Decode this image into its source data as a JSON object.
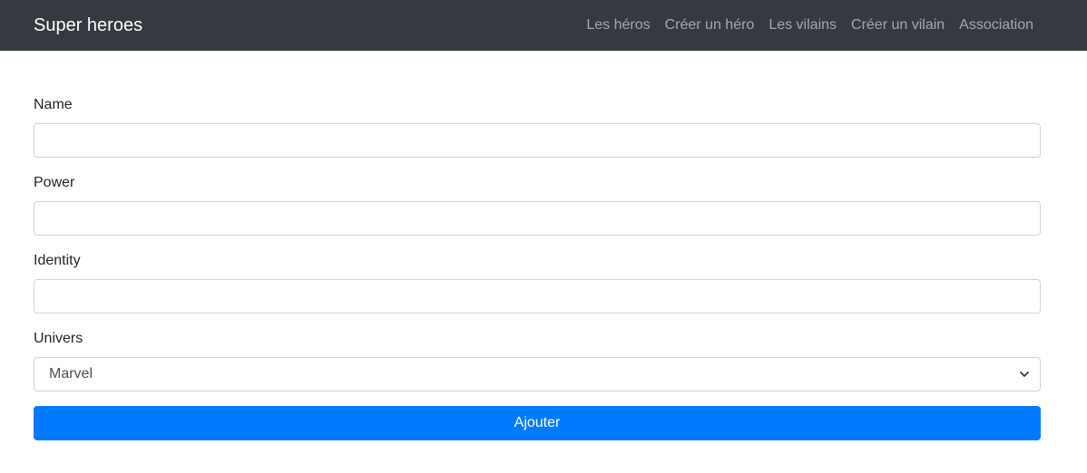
{
  "navbar": {
    "brand": "Super heroes",
    "links": [
      {
        "label": "Les héros"
      },
      {
        "label": "Créer un héro"
      },
      {
        "label": "Les vilains"
      },
      {
        "label": "Créer un vilain"
      },
      {
        "label": "Association"
      }
    ]
  },
  "form": {
    "name": {
      "label": "Name",
      "value": ""
    },
    "power": {
      "label": "Power",
      "value": ""
    },
    "identity": {
      "label": "Identity",
      "value": ""
    },
    "univers": {
      "label": "Univers",
      "selected": "Marvel",
      "icon": "chevron-down-icon"
    },
    "submit_label": "Ajouter"
  },
  "colors": {
    "navbar_bg": "#343a40",
    "primary": "#007bff",
    "border": "#ced4da"
  }
}
